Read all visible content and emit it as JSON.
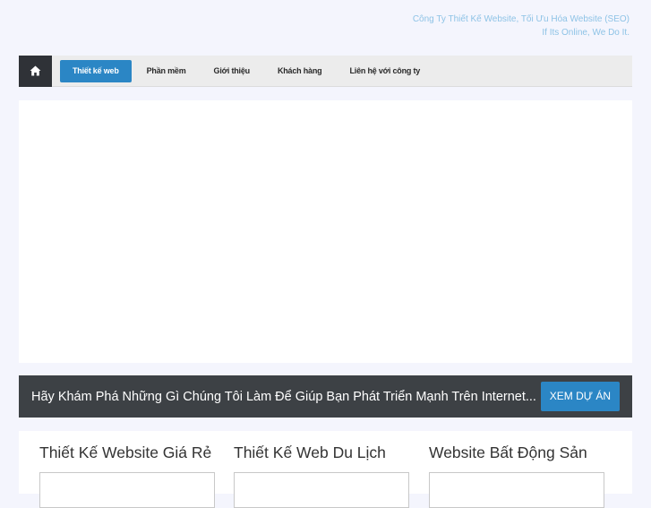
{
  "header": {
    "tagline_line1": "Công Ty Thiết Kế Website, Tối Ưu Hóa Website (SEO)",
    "tagline_line2": "If Its Online, We Do It."
  },
  "nav": {
    "home_icon": "home-icon",
    "items": [
      {
        "label": "Thiết kế web",
        "active": true
      },
      {
        "label": "Phần mềm",
        "active": false
      },
      {
        "label": "Giới thiệu",
        "active": false
      },
      {
        "label": "Khách hàng",
        "active": false
      },
      {
        "label": "Liên hệ với công ty",
        "active": false
      }
    ]
  },
  "cta": {
    "text": "Hãy Khám Phá Những Gì Chúng Tôi Làm Để Giúp Bạn Phát Triển Mạnh Trên Internet...",
    "button_label": "XEM DỰ ÁN"
  },
  "services": [
    {
      "title": "Thiết Kế Website Giá Rẻ"
    },
    {
      "title": "Thiết Kế Web Du Lịch"
    },
    {
      "title": "Website Bất Động Sản"
    }
  ],
  "colors": {
    "accent": "#2b86c5",
    "dark": "#3d4145",
    "tagline": "#8ec3e6",
    "background": "#f4f5fd"
  }
}
